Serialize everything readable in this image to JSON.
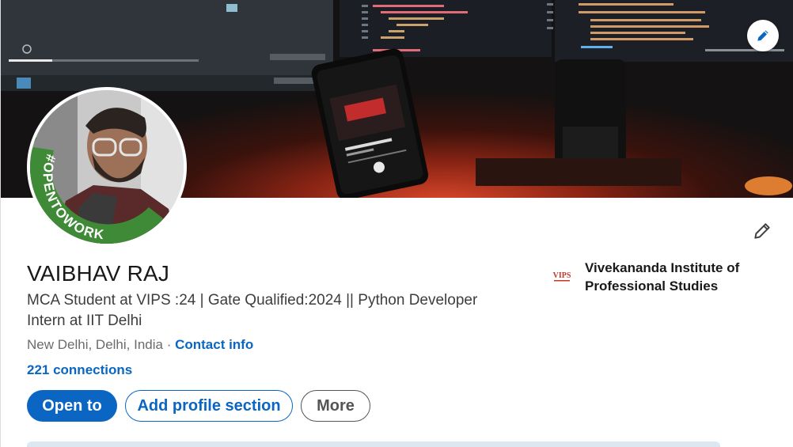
{
  "profile": {
    "name": "VAIBHAV RAJ",
    "headline": "MCA Student at VIPS :24 | Gate Qualified:2024 || Python Developer Intern at IIT Delhi",
    "location": "New Delhi, Delhi, India",
    "separator": " · ",
    "contact_info": "Contact info",
    "connections": "221 connections",
    "open_to_work_badge": "#OPENTOWORK"
  },
  "actions": {
    "open_to": "Open to",
    "add_section": "Add profile section",
    "more": "More"
  },
  "education": {
    "school_name": "Vivekananda Institute of Professional Studies",
    "logo_text": "VIPS"
  },
  "colors": {
    "brand_blue": "#0a66c2",
    "open_to_work_green": "#3f8a36",
    "text_primary": "#191919",
    "text_secondary": "#6b6b6b"
  },
  "icons": {
    "banner_edit": "pencil-icon",
    "intro_edit": "pencil-icon"
  }
}
